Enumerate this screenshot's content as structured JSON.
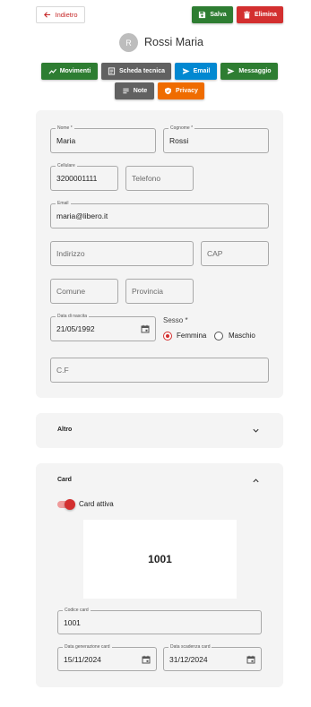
{
  "header": {
    "back_label": "Indietro",
    "save_label": "Salva",
    "delete_label": "Elimina",
    "avatar_initial": "R",
    "person_name": "Rossi Maria"
  },
  "actions": [
    {
      "label": "Movimenti",
      "icon": "chart-line-icon",
      "color": "#2e7d32"
    },
    {
      "label": "Scheda tecnica",
      "icon": "document-icon",
      "color": "#616161"
    },
    {
      "label": "Email",
      "icon": "send-icon",
      "color": "#0288d1"
    },
    {
      "label": "Messaggio",
      "icon": "send-icon",
      "color": "#2e7d32"
    },
    {
      "label": "Note",
      "icon": "notes-icon",
      "color": "#616161"
    },
    {
      "label": "Privacy",
      "icon": "shield-icon",
      "color": "#ef6c00"
    }
  ],
  "form": {
    "nome": {
      "label": "Nome *",
      "value": "Maria"
    },
    "cognome": {
      "label": "Cognome *",
      "value": "Rossi"
    },
    "cellulare": {
      "label": "Cellulare",
      "value": "3200001111"
    },
    "telefono": {
      "placeholder": "Telefono"
    },
    "email": {
      "label": "Email",
      "value": "maria@libero.it"
    },
    "indirizzo": {
      "placeholder": "Indirizzo"
    },
    "cap": {
      "placeholder": "CAP"
    },
    "comune": {
      "placeholder": "Comune"
    },
    "provincia": {
      "placeholder": "Provincia"
    },
    "data_nascita": {
      "label": "Data di nascita",
      "value": "21/05/1992"
    },
    "sesso": {
      "label": "Sesso *",
      "options": [
        "Femmina",
        "Maschio"
      ],
      "selected": "Femmina"
    },
    "cf": {
      "placeholder": "C.F"
    }
  },
  "altro": {
    "title": "Altro"
  },
  "card": {
    "title": "Card",
    "toggle_label": "Card attiva",
    "toggle_on": true,
    "preview_number": "1001",
    "codice": {
      "label": "Codice card",
      "value": "1001"
    },
    "data_generazione": {
      "label": "Data generazione card",
      "value": "15/11/2024"
    },
    "data_scadenza": {
      "label": "Data scadenza card",
      "value": "31/12/2024"
    }
  },
  "colors": {
    "save": "#2e7d32",
    "delete": "#d32f2f",
    "accent_red": "#d32f2f",
    "panel_bg": "#f4f4f4"
  }
}
